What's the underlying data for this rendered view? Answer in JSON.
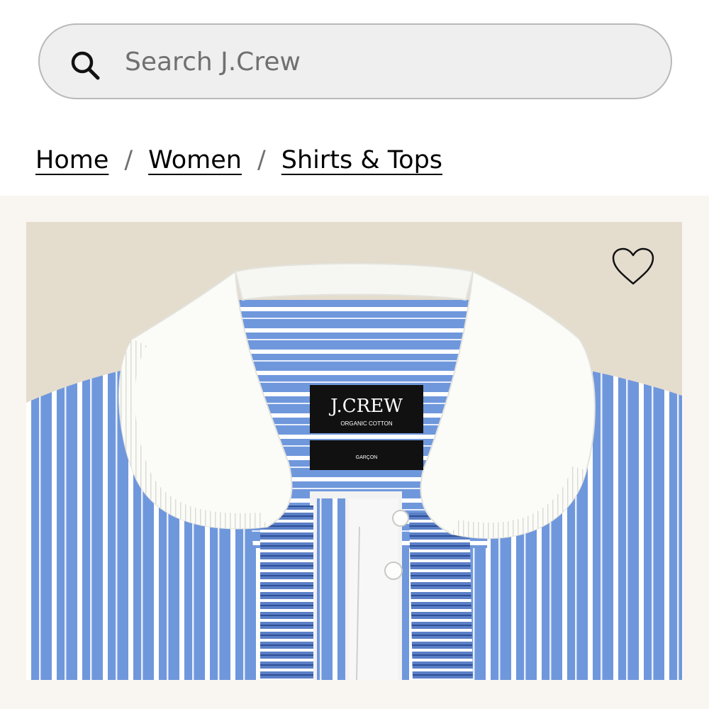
{
  "search": {
    "placeholder": "Search J.Crew",
    "icon": "search-icon"
  },
  "breadcrumb": {
    "items": [
      "Home",
      "Women",
      "Shirts & Tops"
    ],
    "separator": "/"
  },
  "product": {
    "image_alt": "Blue and white striped shirt with white ruffled Peter Pan collar",
    "label_brand": "J.CREW",
    "label_sub": "ORGANIC COTTON",
    "label_fit": "GARÇON",
    "wishlist_icon": "heart-icon"
  },
  "colors": {
    "page_bg": "#ffffff",
    "search_bg": "#efefef",
    "image_bg": "#e4dccd",
    "stripe_blue": "#6f97dc"
  }
}
